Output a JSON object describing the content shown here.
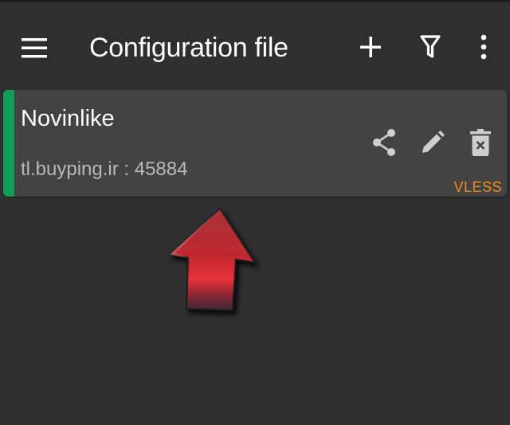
{
  "app_bar": {
    "title": "Configuration file",
    "icons": {
      "menu": "hamburger-menu-icon",
      "add": "plus-icon",
      "filter": "filter-icon",
      "more": "more-vertical-icon"
    }
  },
  "server_list": [
    {
      "name": "Novinlike",
      "address": "tl.buyping.ir : 45884",
      "protocol": "VLESS",
      "selected": true,
      "accent_color": "#0f9d58",
      "actions": [
        "share-icon",
        "edit-pencil-icon",
        "delete-trash-icon"
      ]
    }
  ],
  "colors": {
    "background": "#2f2f2f",
    "card": "#434343",
    "protocol": "#f28b20",
    "icon": "#cfcfcf",
    "overlay_arrow": "#c62828"
  }
}
